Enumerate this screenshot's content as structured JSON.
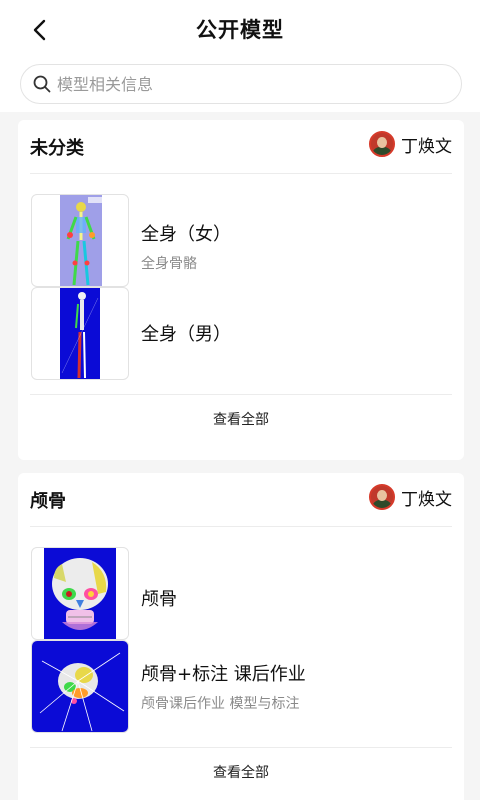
{
  "header": {
    "title": "公开模型"
  },
  "search": {
    "placeholder": "模型相关信息"
  },
  "groups": [
    {
      "title": "未分类",
      "owner": "丁焕文",
      "items": [
        {
          "title": "全身（女）",
          "subtitle": "全身骨骼"
        },
        {
          "title": "全身（男）",
          "subtitle": ""
        }
      ],
      "more": "查看全部"
    },
    {
      "title": "颅骨",
      "owner": "丁焕文",
      "items": [
        {
          "title": "颅骨",
          "subtitle": ""
        },
        {
          "title": "颅骨+标注 课后作业",
          "subtitle": "颅骨课后作业 模型与标注"
        }
      ],
      "more": "查看全部"
    }
  ],
  "colors": {
    "accent_blue": "#0b0bd6",
    "lavender": "#9f9fe8",
    "avatar_red": "#c0392b"
  },
  "icons": {
    "back": "chevron-left-icon",
    "search": "search-icon"
  }
}
